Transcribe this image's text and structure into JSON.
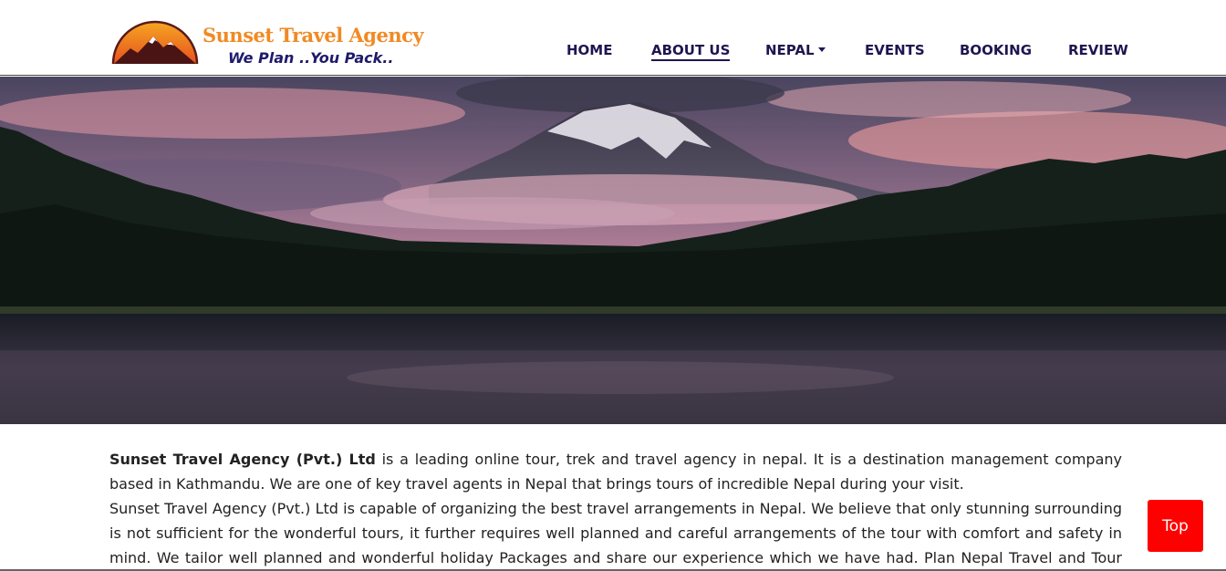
{
  "brand": {
    "name": "Sunset Travel Agency",
    "tagline": "We Plan ..You Pack.."
  },
  "nav": {
    "items": [
      {
        "label": "HOME",
        "active": false
      },
      {
        "label": "ABOUT US",
        "active": true
      },
      {
        "label": "NEPAL",
        "active": false,
        "dropdown": true
      },
      {
        "label": "EVENTS",
        "active": false
      },
      {
        "label": "BOOKING",
        "active": false
      },
      {
        "label": "REVIEW",
        "active": false
      }
    ]
  },
  "about": {
    "company_bold": "Sunset Travel Agency (Pvt.) Ltd",
    "intro_rest": " is a leading online tour, trek and travel agency in nepal. It is a destination management company based in Kathmandu. We are one of key travel agents in Nepal that brings tours of incredible Nepal during your visit.",
    "paragraph2": "Sunset Travel Agency (Pvt.) Ltd is capable of organizing the best travel arrangements in Nepal. We believe that only stunning surrounding is not sufficient for the wonderful tours, it further requires well planned and careful arrangements of the tour with comfort and safety in mind. We tailor well planned and wonderful holiday Packages and share our experience which we have had. Plan Nepal Travel and Tour offers you"
  },
  "top_button": {
    "label": "Top"
  },
  "colors": {
    "nav_text": "#1f1550",
    "brand_orange": "#f08a24",
    "brand_navy": "#1f1a6b",
    "top_button": "#ff0000"
  },
  "icons": {
    "dropdown": "caret-down-icon",
    "logo": "sunset-mountain-logo"
  }
}
